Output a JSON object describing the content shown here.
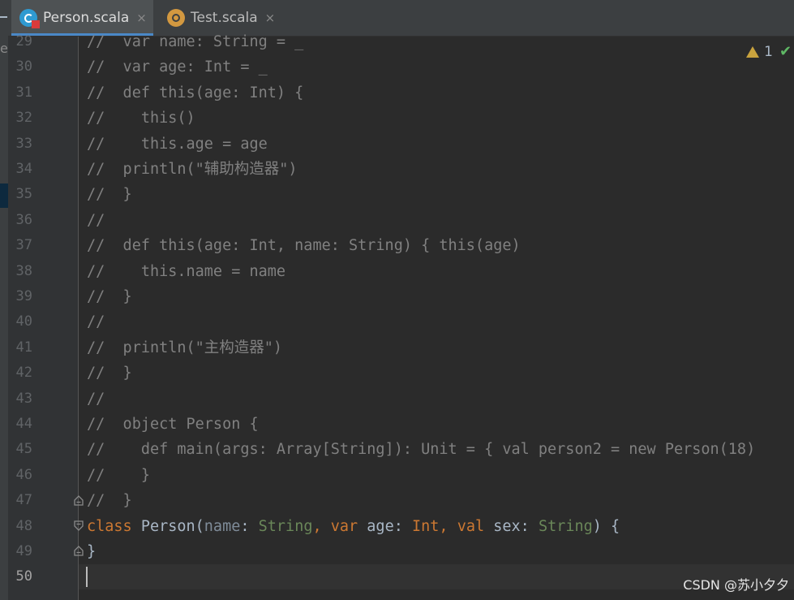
{
  "left_strip": {
    "label": "e"
  },
  "tabs": [
    {
      "label": "Person.scala",
      "icon": "scala-class-icon",
      "active": true
    },
    {
      "label": "Test.scala",
      "icon": "scala-object-icon",
      "active": false
    }
  ],
  "close_glyph": "×",
  "inspections": {
    "warnings": "1"
  },
  "editor": {
    "current_line": "50",
    "lines": [
      {
        "n": "29",
        "parts": [
          [
            "cm",
            "//  var name: String = _"
          ]
        ]
      },
      {
        "n": "30",
        "parts": [
          [
            "cm",
            "//  var age: Int = _"
          ]
        ]
      },
      {
        "n": "31",
        "parts": [
          [
            "cm",
            "//  def this(age: Int) {"
          ]
        ]
      },
      {
        "n": "32",
        "parts": [
          [
            "cm",
            "//    this()"
          ]
        ]
      },
      {
        "n": "33",
        "parts": [
          [
            "cm",
            "//    this.age = age"
          ]
        ]
      },
      {
        "n": "34",
        "parts": [
          [
            "cm",
            "//  println(\"辅助构造器\")"
          ]
        ]
      },
      {
        "n": "35",
        "parts": [
          [
            "cm",
            "//  }"
          ]
        ]
      },
      {
        "n": "36",
        "parts": [
          [
            "cm",
            "//"
          ]
        ]
      },
      {
        "n": "37",
        "parts": [
          [
            "cm",
            "//  def this(age: Int, name: String) { this(age)"
          ]
        ]
      },
      {
        "n": "38",
        "parts": [
          [
            "cm",
            "//    this.name = name"
          ]
        ]
      },
      {
        "n": "39",
        "parts": [
          [
            "cm",
            "//  }"
          ]
        ]
      },
      {
        "n": "40",
        "parts": [
          [
            "cm",
            "//"
          ]
        ]
      },
      {
        "n": "41",
        "parts": [
          [
            "cm",
            "//  println(\"主构造器\")"
          ]
        ]
      },
      {
        "n": "42",
        "parts": [
          [
            "cm",
            "//  }"
          ]
        ]
      },
      {
        "n": "43",
        "parts": [
          [
            "cm",
            "//"
          ]
        ]
      },
      {
        "n": "44",
        "parts": [
          [
            "cm",
            "//  object Person {"
          ]
        ]
      },
      {
        "n": "45",
        "parts": [
          [
            "cm",
            "//    def main(args: Array[String]): Unit = { val person2 = new Person(18)"
          ]
        ]
      },
      {
        "n": "46",
        "parts": [
          [
            "cm",
            "//    }"
          ]
        ]
      },
      {
        "n": "47",
        "parts": [
          [
            "cm",
            "//  }"
          ]
        ]
      },
      {
        "n": "48",
        "parts": [
          [
            "kw",
            "class "
          ],
          [
            "id",
            "Person("
          ],
          [
            "pr",
            "name"
          ],
          [
            "id",
            ": "
          ],
          [
            "ty",
            "String"
          ],
          [
            "kw",
            ", var "
          ],
          [
            "id",
            "age: "
          ],
          [
            "kw",
            "Int"
          ],
          [
            "kw",
            ", val "
          ],
          [
            "id",
            "sex: "
          ],
          [
            "ty",
            "String"
          ],
          [
            "id",
            ") {"
          ]
        ]
      },
      {
        "n": "49",
        "parts": [
          [
            "id",
            "}"
          ]
        ]
      },
      {
        "n": "50",
        "parts": []
      }
    ]
  },
  "watermark": "CSDN @苏小夕夕"
}
